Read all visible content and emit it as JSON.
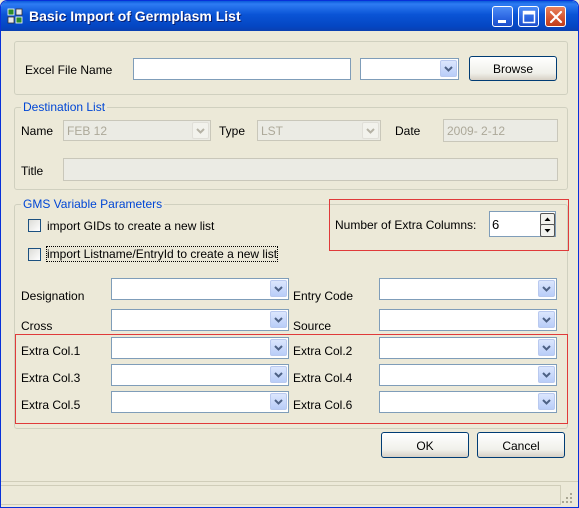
{
  "window": {
    "title": "Basic Import of Germplasm List"
  },
  "excel": {
    "label": "Excel File Name",
    "file_value": "",
    "sheet_value": "",
    "browse_label": "Browse"
  },
  "destination": {
    "group_title": "Destination List",
    "name_label": "Name",
    "name_value": "FEB 12",
    "type_label": "Type",
    "type_value": "LST",
    "date_label": "Date",
    "date_value": "2009- 2-12",
    "title_label": "Title",
    "title_value": ""
  },
  "gms": {
    "group_title": "GMS Variable Parameters",
    "import_gids_label": "import GIDs to create a new list",
    "import_gids_checked": false,
    "import_listname_label": "import Listname/EntryId to create a new list",
    "import_listname_checked": false,
    "extra_columns_label": "Number of Extra Columns:",
    "extra_columns_value": "6"
  },
  "fields": {
    "designation_label": "Designation",
    "entry_code_label": "Entry Code",
    "cross_label": "Cross",
    "source_label": "Source",
    "extra_col_1_label": "Extra Col.1",
    "extra_col_2_label": "Extra Col.2",
    "extra_col_3_label": "Extra Col.3",
    "extra_col_4_label": "Extra Col.4",
    "extra_col_5_label": "Extra Col.5",
    "extra_col_6_label": "Extra Col.6"
  },
  "actions": {
    "ok_label": "OK",
    "cancel_label": "Cancel"
  },
  "colors": {
    "titlebar": "#0a54d6",
    "highlight_border": "#e03a3a",
    "group_title": "#0046d5",
    "dialog_bg": "#ece9d8"
  },
  "icons": [
    "app-icon",
    "minimize-icon",
    "maximize-icon",
    "close-icon",
    "dropdown-arrow-icon",
    "spin-up-icon",
    "spin-down-icon",
    "resize-grip-icon"
  ]
}
